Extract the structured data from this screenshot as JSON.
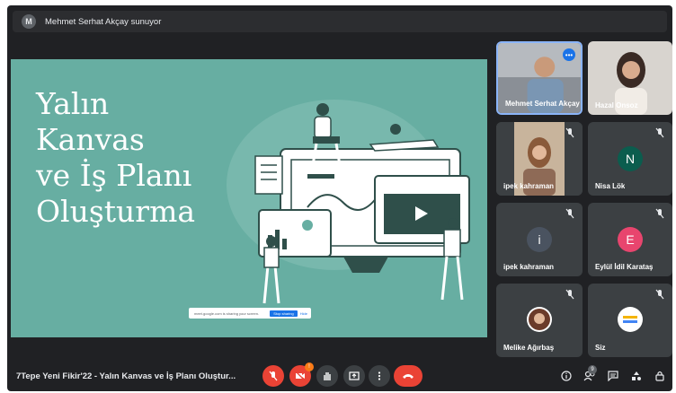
{
  "header": {
    "avatar_letter": "M",
    "presenting_text": "Mehmet Serhat Akçay sunuyor"
  },
  "slide": {
    "title": "Yalın\nKanvas\nve İş Planı\nOluşturma",
    "share_notice": "meet.google.com is sharing your screen.",
    "stop_sharing": "Stop sharing",
    "hide": "Hide"
  },
  "participants": [
    {
      "name": "Mehmet Serhat Akçay",
      "type": "video"
    },
    {
      "name": "Hazal Onsoz",
      "type": "video"
    },
    {
      "name": "ipek kahraman",
      "type": "video",
      "muted": true
    },
    {
      "name": "Nisa Lök",
      "type": "avatar",
      "letter": "N",
      "color": "#0b5d4e",
      "muted": true
    },
    {
      "name": "ipek kahraman",
      "type": "avatar",
      "letter": "i",
      "color": "#4a5360",
      "muted": true
    },
    {
      "name": "Eylül İdil Karataş",
      "type": "avatar",
      "letter": "E",
      "color": "#e8456e",
      "muted": true
    },
    {
      "name": "Melike Ağırbaş",
      "type": "photo",
      "muted": true
    },
    {
      "name": "Siz",
      "type": "logo",
      "muted": true
    }
  ],
  "footer": {
    "meeting_title": "7Tepe Yeni Fikir'22 - Yalın Kanvas ve İş Planı Oluştur...",
    "camera_badge": "!",
    "people_count": "9"
  },
  "colors": {
    "background": "#202124",
    "tile": "#3c4043",
    "slide": "#67aea2",
    "red": "#ea4335",
    "accent": "#1a73e8"
  }
}
